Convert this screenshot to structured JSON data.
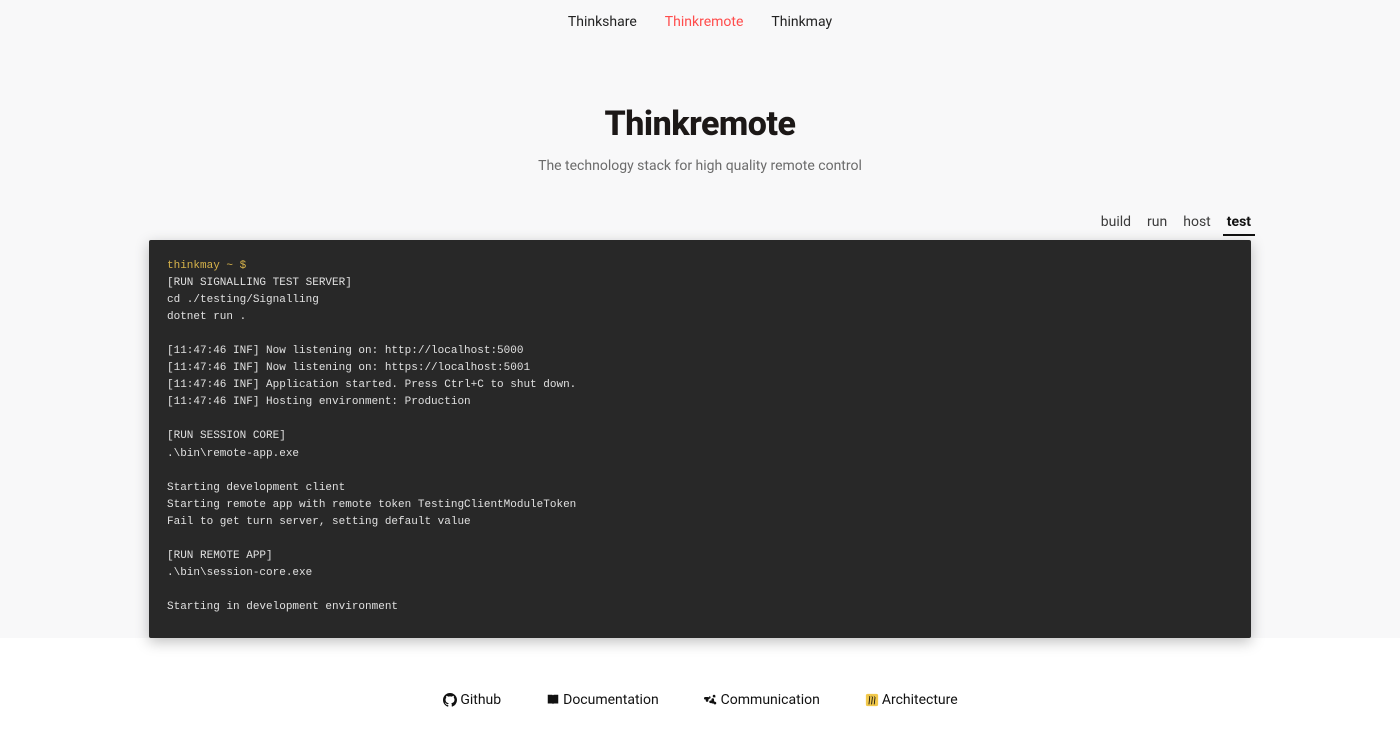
{
  "nav": {
    "items": [
      {
        "label": "Thinkshare",
        "active": false
      },
      {
        "label": "Thinkremote",
        "active": true
      },
      {
        "label": "Thinkmay",
        "active": false
      }
    ]
  },
  "hero": {
    "title": "Thinkremote",
    "subtitle": "The technology stack for high quality remote control"
  },
  "tabs": {
    "items": [
      {
        "label": "build",
        "active": false
      },
      {
        "label": "run",
        "active": false
      },
      {
        "label": "host",
        "active": false
      },
      {
        "label": "test",
        "active": true
      }
    ]
  },
  "terminal": {
    "prompt": "thinkmay ~ $",
    "body": "[RUN SIGNALLING TEST SERVER]\ncd ./testing/Signalling\ndotnet run .\n\n[11:47:46 INF] Now listening on: http://localhost:5000\n[11:47:46 INF] Now listening on: https://localhost:5001\n[11:47:46 INF] Application started. Press Ctrl+C to shut down.\n[11:47:46 INF] Hosting environment: Production\n\n[RUN SESSION CORE]\n.\\bin\\remote-app.exe\n\nStarting development client\nStarting remote app with remote token TestingClientModuleToken\nFail to get turn server, setting default value\n\n[RUN REMOTE APP]\n.\\bin\\session-core.exe\n\nStarting in development environment"
  },
  "footer": {
    "links": [
      {
        "label": "Github",
        "icon": "github-icon"
      },
      {
        "label": "Documentation",
        "icon": "book-icon"
      },
      {
        "label": "Communication",
        "icon": "slack-icon"
      },
      {
        "label": "Architecture",
        "icon": "miro-icon"
      }
    ]
  }
}
